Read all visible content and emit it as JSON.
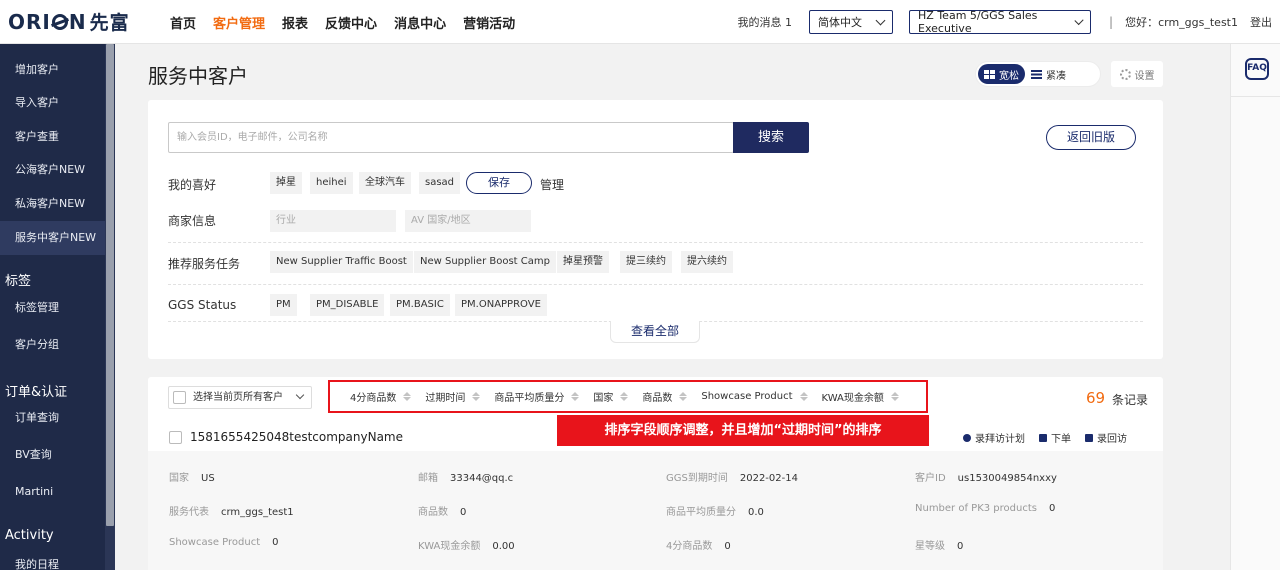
{
  "header": {
    "logo_text": "ORI",
    "logo_text2": "N",
    "logo_cn": "先富",
    "nav": [
      "首页",
      "客户管理",
      "报表",
      "反馈中心",
      "消息中心",
      "营销活动"
    ],
    "active_nav": "客户管理",
    "my_messages": "我的消息 1",
    "language": "简体中文",
    "team": "HZ Team 5/GGS Sales Executive",
    "divider": "|",
    "greeting": "您好：crm_ggs_test1",
    "logout": "登出"
  },
  "sidebar": {
    "items": [
      {
        "label": "增加客户"
      },
      {
        "label": "导入客户"
      },
      {
        "label": "客户查重"
      },
      {
        "label": "公海客户NEW"
      },
      {
        "label": "私海客户NEW"
      },
      {
        "label": "服务中客户NEW",
        "active": true
      }
    ],
    "group_tags": "标签",
    "tag_items": [
      "标签管理",
      "客户分组"
    ],
    "group_orders": "订单&认证",
    "order_items": [
      "订单查询",
      "BV查询",
      "Martini"
    ],
    "group_activity": "Activity",
    "activity_items": [
      "我的日程"
    ]
  },
  "rail": {
    "faq": "FAQ"
  },
  "page": {
    "title": "服务中客户",
    "view_loose": "宽松",
    "view_compact": "紧凑",
    "settings": "设置"
  },
  "filters": {
    "search_placeholder": "输入会员ID，电子邮件，公司名称",
    "search_button": "搜索",
    "back_button": "返回旧版",
    "fav_label": "我的喜好",
    "fav_tags": [
      "掉星",
      "heihei",
      "全球汽车",
      "sasad"
    ],
    "save_button": "保存",
    "manage": "管理",
    "merchant_label": "商家信息",
    "industry_placeholder": "行业",
    "country_placeholder": "AV 国家/地区",
    "task_label": "推荐服务任务",
    "task_tags": [
      "New Supplier Traffic Boost",
      "New Supplier Boost Camp",
      "掉星预警",
      "提三续约",
      "提六续约"
    ],
    "ggs_label": "GGS Status",
    "ggs_tags": [
      "PM",
      "PM_DISABLE",
      "PM.BASIC",
      "PM.ONAPPROVE"
    ],
    "view_all": "查看全部"
  },
  "results": {
    "select_all": "选择当前页所有客户",
    "sort_fields": [
      "4分商品数",
      "过期时间",
      "商品平均质量分",
      "国家",
      "商品数",
      "Showcase Product",
      "KWA现金余额"
    ],
    "count": "69",
    "count_label": "条记录",
    "annotation": "排序字段顺序调整，并且增加“过期时间”的排序",
    "record": {
      "title": "1581655425048testcompanyName",
      "actions": [
        "录拜访计划",
        "下单",
        "录回访"
      ],
      "fields": [
        {
          "k": "国家",
          "v": "US"
        },
        {
          "k": "邮箱",
          "v": "33344@qq.c"
        },
        {
          "k": "GGS到期时间",
          "v": "2022-02-14"
        },
        {
          "k": "客户ID",
          "v": "us1530049854nxxy"
        },
        {
          "k": "服务代表",
          "v": "crm_ggs_test1"
        },
        {
          "k": "商品数",
          "v": "0"
        },
        {
          "k": "商品平均质量分",
          "v": "0.0"
        },
        {
          "k": "Number of PK3 products",
          "v": "0"
        },
        {
          "k": "Showcase Product",
          "v": "0"
        },
        {
          "k": "KWA现金余额",
          "v": "0.00"
        },
        {
          "k": "4分商品数",
          "v": "0"
        },
        {
          "k": "星等级",
          "v": "0"
        }
      ]
    }
  },
  "colors": {
    "accent": "#f26b11",
    "brand": "#1f2a60",
    "annotation": "#e8141b",
    "sidebar": "#1f2a48"
  }
}
